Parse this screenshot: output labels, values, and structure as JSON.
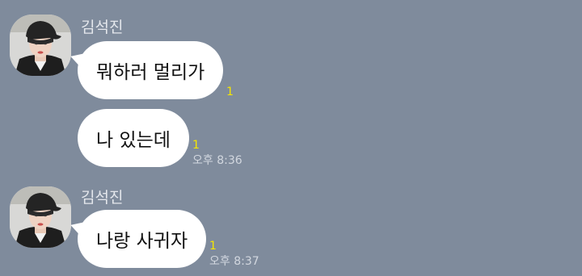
{
  "chat": {
    "groups": [
      {
        "sender": "김석진",
        "avatar_icon": "profile-photo-icon",
        "messages": [
          {
            "text": "뭐하러 멀리가",
            "unread": "1",
            "time": ""
          },
          {
            "text": "나 있는데",
            "unread": "1",
            "time": "오후 8:36"
          }
        ]
      },
      {
        "sender": "김석진",
        "avatar_icon": "profile-photo-icon",
        "messages": [
          {
            "text": "나랑 사귀자",
            "unread": "1",
            "time": "오후 8:37"
          }
        ]
      }
    ]
  },
  "colors": {
    "background": "#7f8b9c",
    "bubble": "#ffffff",
    "unread": "#f5e600",
    "time": "#d2d7df",
    "sender_name": "#e4e7ec"
  }
}
